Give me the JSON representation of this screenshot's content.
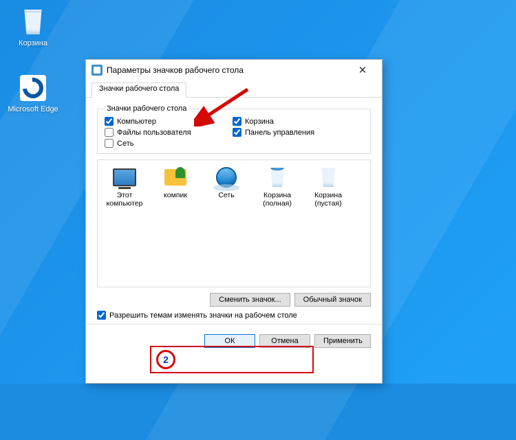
{
  "desktop_icons": {
    "recycle_bin": "Корзина",
    "edge": "Microsoft Edge"
  },
  "dialog": {
    "title": "Параметры значков рабочего стола",
    "tab": "Значки рабочего стола",
    "group_legend": "Значки рабочего стола",
    "checks": {
      "computer": "Компьютер",
      "user_files": "Файлы пользователя",
      "network": "Сеть",
      "recycle_bin": "Корзина",
      "control_panel": "Панель управления"
    },
    "preview": {
      "this_pc": "Этот компьютер",
      "kompik": "компик",
      "network": "Сеть",
      "bin_full": "Корзина (полная)",
      "bin_empty": "Корзина (пустая)"
    },
    "change_icon": "Сменить значок...",
    "default_icon": "Обычный значок",
    "allow_themes": "Разрешить темам изменять значки на рабочем столе",
    "ok": "ОК",
    "cancel": "Отмена",
    "apply": "Применить"
  },
  "annotation": {
    "step": "2"
  }
}
